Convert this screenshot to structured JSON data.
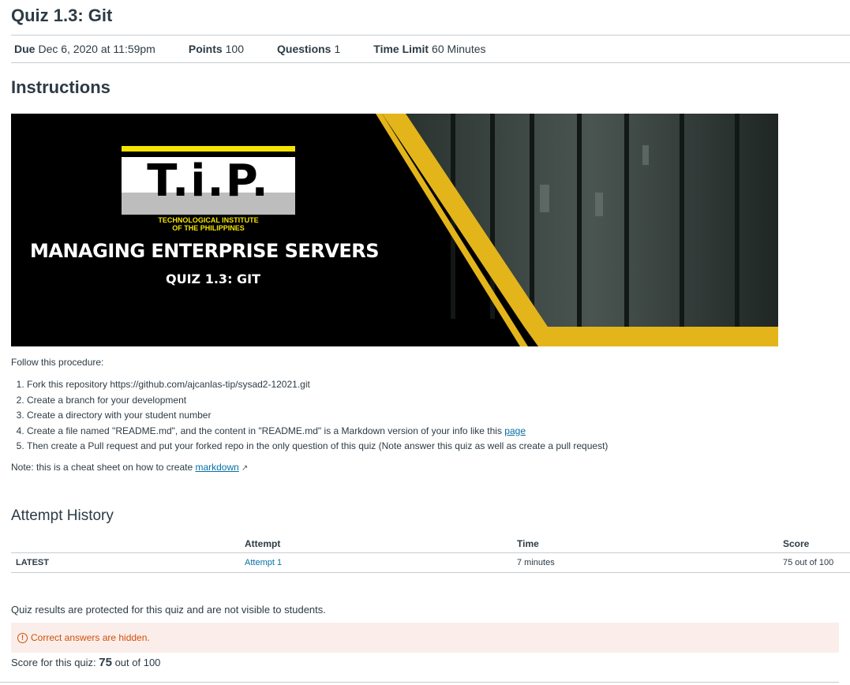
{
  "quiz": {
    "title": "Quiz 1.3: Git"
  },
  "meta": [
    {
      "key": "Due",
      "value": "Dec 6, 2020 at 11:59pm"
    },
    {
      "key": "Points",
      "value": "100"
    },
    {
      "key": "Questions",
      "value": "1"
    },
    {
      "key": "Time Limit",
      "value": "60 Minutes"
    }
  ],
  "instructions": {
    "heading": "Instructions",
    "banner": {
      "logo_text": "T.i.P.",
      "logo_sub1": "TECHNOLOGICAL INSTITUTE",
      "logo_sub2": "OF THE PHILIPPINES",
      "course": "MANAGING ENTERPRISE SERVERS",
      "quiz_label": "QUIZ 1.3: GIT",
      "accent_color": "#e3b51a"
    },
    "intro": "Follow this procedure:",
    "steps": [
      "Fork this repository https://github.com/ajcanlas-tip/sysad2-12021.git",
      "Create a branch for your development",
      "Create a directory with your student number",
      "Create a file named \"README.md\", and the content in \"README.md\" is a Markdown version of your info like this ",
      "Then create a Pull request and put your forked repo in the only question of this quiz (Note answer this quiz as well as create a pull request)"
    ],
    "step4_link": "page",
    "note": "Note: this is a cheat sheet on how to create ",
    "note_link": "markdown",
    "note_link_icon": "external-link-icon"
  },
  "attempt_history": {
    "heading": "Attempt History",
    "columns": [
      "",
      "Attempt",
      "Time",
      "Score"
    ],
    "rows": [
      {
        "label": "LATEST",
        "attempt": "Attempt 1",
        "time": "7 minutes",
        "score": "75 out of 100"
      }
    ]
  },
  "results": {
    "protected_text": "Quiz results are protected for this quiz and are not visible to students.",
    "hidden_text": "Correct answers are hidden.",
    "hidden_icon": "alert-circle-icon",
    "score_prefix": "Score for this quiz: ",
    "score_value": "75",
    "score_suffix": " out of 100"
  }
}
